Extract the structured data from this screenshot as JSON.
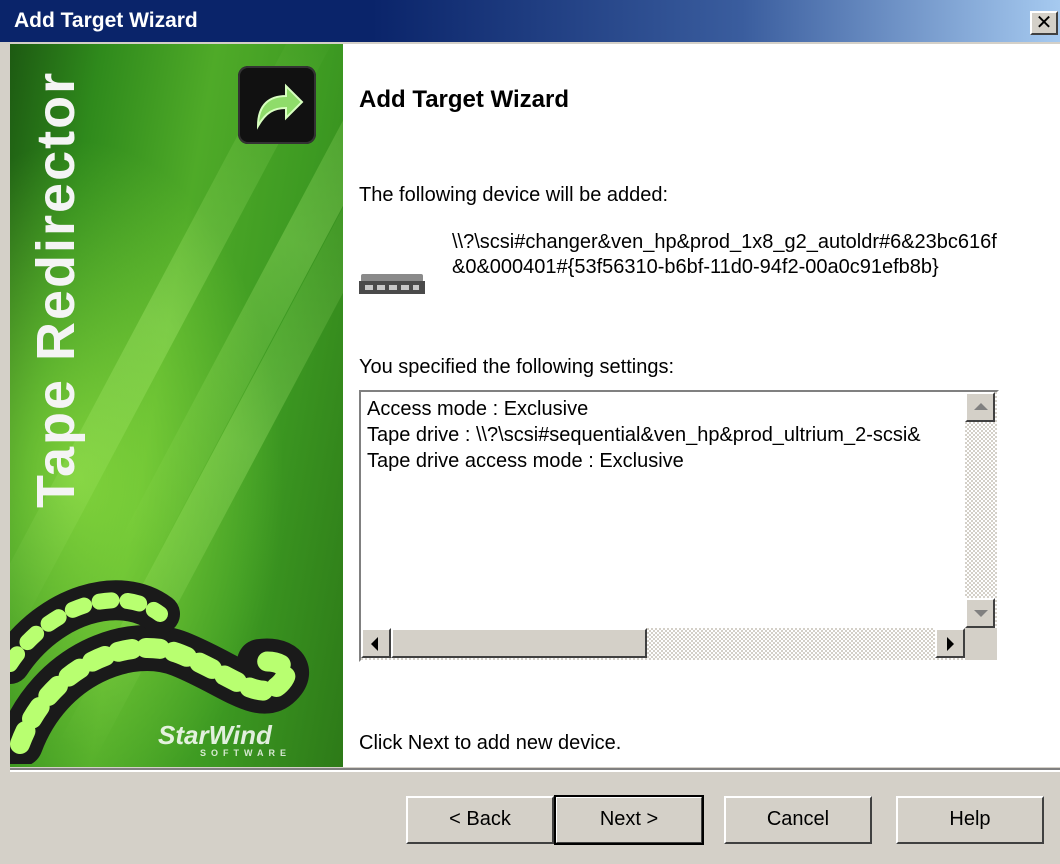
{
  "window": {
    "title": "Add Target Wizard",
    "close_glyph": "✕"
  },
  "side_panel": {
    "product_name": "Tape Redirector",
    "logo_icon": "forward-arrow-icon",
    "brand_name": "StarWind",
    "brand_sub": "SOFTWARE"
  },
  "content": {
    "heading": "Add Target Wizard",
    "intro": "The following device will be added:",
    "device_icon": "tape-library-icon",
    "device_path": "\\\\?\\scsi#changer&ven_hp&prod_1x8_g2_autoldr#6&23bc616f&0&000401#{53f56310-b6bf-11d0-94f2-00a0c91efb8b}",
    "settings_label": "You specified the following settings:",
    "settings": [
      "Access mode : Exclusive",
      "Tape drive : \\\\?\\scsi#sequential&ven_hp&prod_ultrium_2-scsi&",
      "Tape drive access mode : Exclusive"
    ],
    "footer_note": "Click Next to add new device."
  },
  "buttons": {
    "back": "< Back",
    "next": "Next >",
    "cancel": "Cancel",
    "help": "Help"
  },
  "colors": {
    "titlebar": "#0a246a",
    "panel_green": "#3d9a22",
    "dialog_face": "#d4d0c8"
  }
}
